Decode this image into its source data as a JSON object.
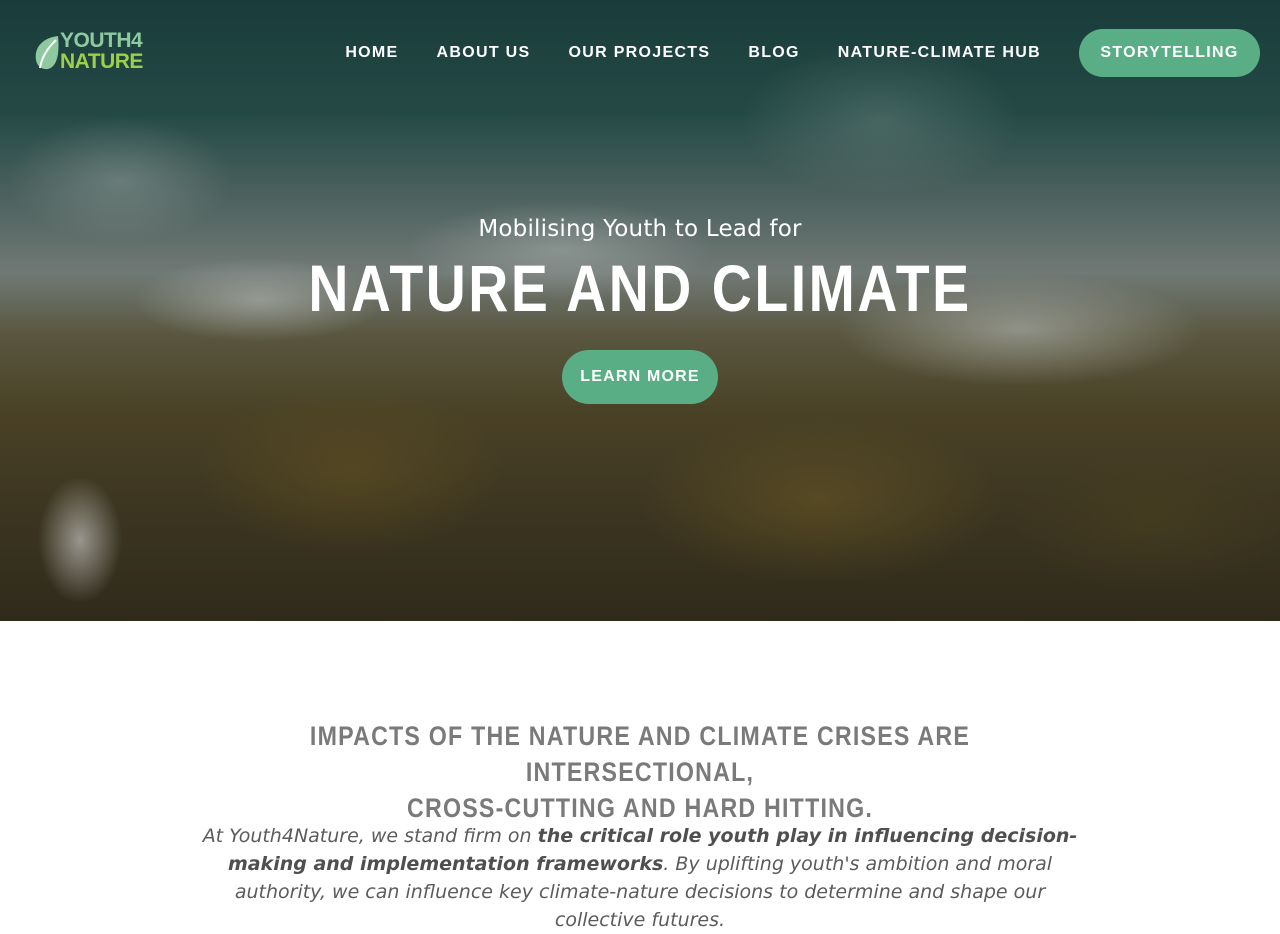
{
  "brand": {
    "line1": "YOUTH4",
    "line2": "NATURE",
    "leaf_icon": "leaf-icon",
    "colors": {
      "line1": "#8fc9a0",
      "line2": "#9ccf4a"
    }
  },
  "nav": {
    "items": [
      {
        "label": "HOME"
      },
      {
        "label": "ABOUT US"
      },
      {
        "label": "OUR PROJECTS"
      },
      {
        "label": "BLOG"
      },
      {
        "label": "NATURE-CLIMATE HUB"
      }
    ],
    "cta_label": "STORYTELLING"
  },
  "hero": {
    "subtitle": "Mobilising Youth to Lead for",
    "title": "NATURE AND CLIMATE",
    "button_label": "LEARN MORE"
  },
  "intro": {
    "heading_line1": "IMPACTS OF THE NATURE AND CLIMATE CRISES ARE INTERSECTIONAL,",
    "heading_line2": "CROSS-CUTTING AND HARD HITTING.",
    "text_part1": "At Youth4Nature, we stand firm on ",
    "text_bold": "the critical role youth play in influencing decision-making and implementation frameworks",
    "text_part2": ". By uplifting youth's ambition and moral authority, we can influence key climate-nature decisions to determine and shape our collective futures."
  },
  "colors": {
    "accent": "#5aae86",
    "heading_gray": "#7a7a7a",
    "body_gray": "#5b5b5b"
  }
}
